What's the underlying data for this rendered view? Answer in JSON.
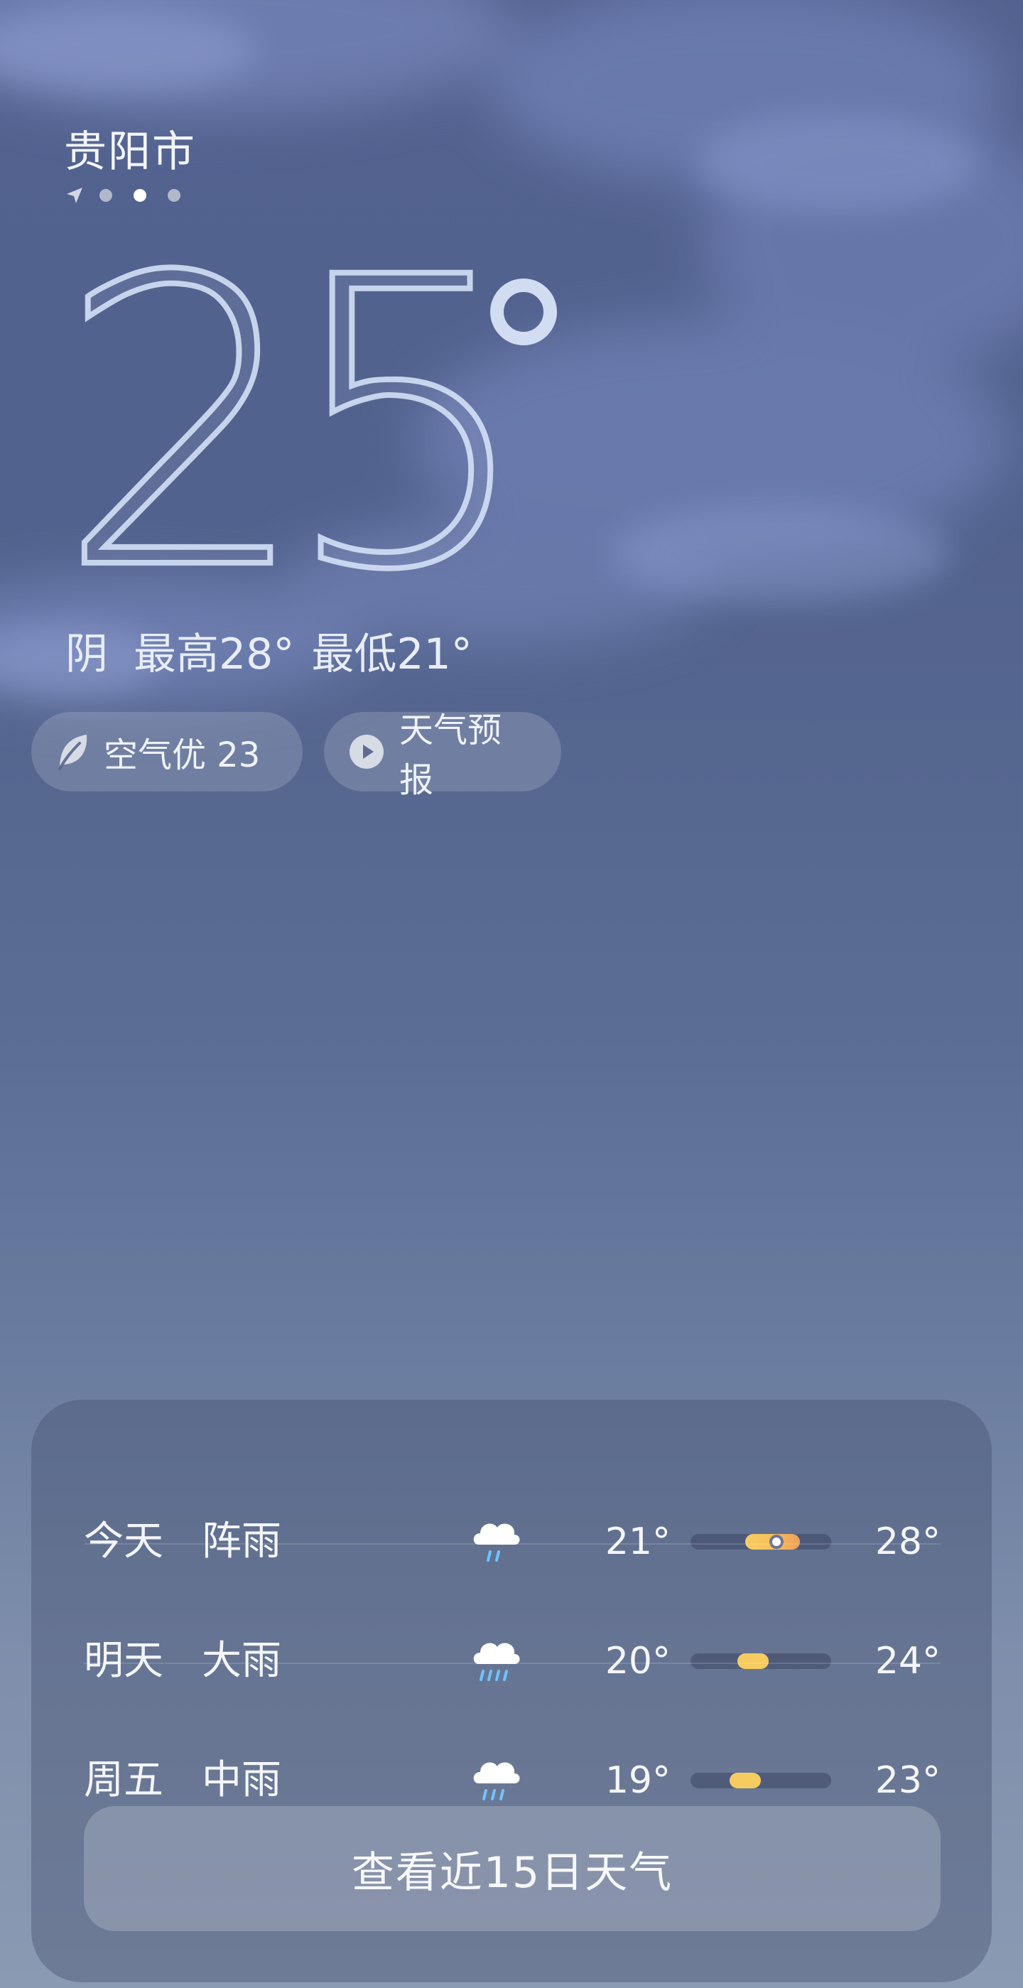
{
  "header": {
    "city": "贵阳市",
    "page_dots": 3,
    "active_dot": 1
  },
  "current": {
    "temperature": "25",
    "degree_symbol": "°",
    "condition": "阴",
    "high": "最高28°",
    "low": "最低21°"
  },
  "chips": {
    "air_label": "空气优 23",
    "forecast_label": "天气预报"
  },
  "forecast": {
    "rows": [
      {
        "day": "今天",
        "condition": "阵雨",
        "icon": "shower-icon",
        "low": "21°",
        "high": "28°",
        "low_value": 21,
        "high_value": 28,
        "current_value": 25
      },
      {
        "day": "明天",
        "condition": "大雨",
        "icon": "heavy-rain-icon",
        "low": "20°",
        "high": "24°",
        "low_value": 20,
        "high_value": 24
      },
      {
        "day": "周五",
        "condition": "中雨",
        "icon": "moderate-rain-icon",
        "low": "19°",
        "high": "23°",
        "low_value": 19,
        "high_value": 23
      }
    ],
    "more_button": "查看近15日天气"
  },
  "colors": {
    "bar_warm": "#f6cc60",
    "bar_hot": "#f0a05a",
    "rain_drop": "#6fc3ff"
  }
}
